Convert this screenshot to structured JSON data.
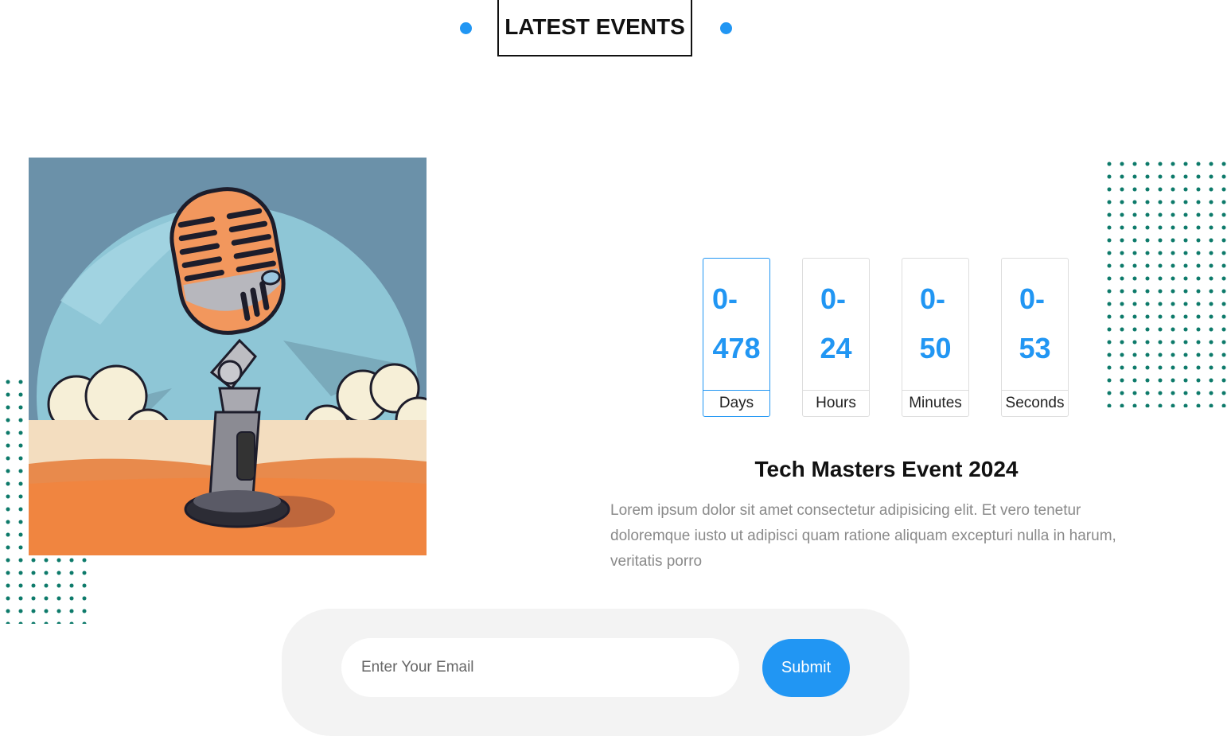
{
  "section": {
    "title": "LATEST EVENTS",
    "accent_color": "#2196f3",
    "dot_pattern_color": "#0d7a6a"
  },
  "event": {
    "image_icon": "microphone-illustration",
    "countdown": [
      {
        "line1": "0-",
        "line2": "478",
        "label": "Days",
        "active": true
      },
      {
        "line1": "0-",
        "line2": "24",
        "label": "Hours",
        "active": false
      },
      {
        "line1": "0-",
        "line2": "50",
        "label": "Minutes",
        "active": false
      },
      {
        "line1": "0-",
        "line2": "53",
        "label": "Seconds",
        "active": false
      }
    ],
    "title": "Tech Masters Event 2024",
    "description": "Lorem ipsum dolor sit amet consectetur adipisicing elit. Et vero tenetur doloremque iusto ut adipisci quam ratione aliquam excepturi nulla in harum, veritatis porro"
  },
  "subscribe": {
    "email_placeholder": "Enter Your Email",
    "email_value": "",
    "submit_label": "Submit"
  }
}
